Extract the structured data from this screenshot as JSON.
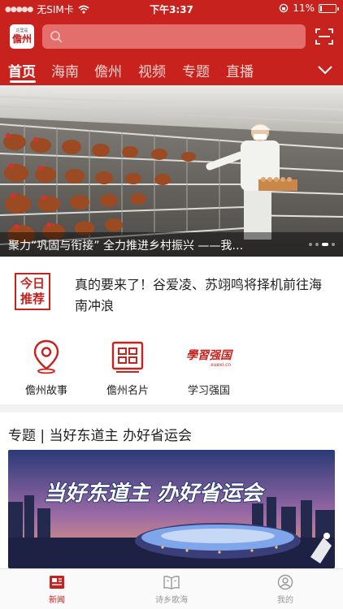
{
  "status_bar": {
    "carrier": "无SIM卡",
    "time": "下午3:37",
    "battery_percent": "11%",
    "battery_level": 0.11
  },
  "header": {
    "logo": {
      "small_text": "这里是",
      "big_text": "儋州"
    },
    "search": {
      "placeholder": ""
    },
    "tabs": [
      {
        "label": "首页",
        "active": true
      },
      {
        "label": "海南",
        "active": false
      },
      {
        "label": "儋州",
        "active": false
      },
      {
        "label": "视频",
        "active": false
      },
      {
        "label": "专题",
        "active": false
      },
      {
        "label": "直播",
        "active": false
      }
    ]
  },
  "banner": {
    "caption": "聚力“巩固与衔接” 全力推进乡村振兴 ——我…",
    "page_count": 4,
    "current_page": 3
  },
  "recommend": {
    "badge_line1": "今日",
    "badge_line2": "推荐",
    "headline": "真的要来了！谷爱凌、苏翊鸣将择机前往海南冲浪"
  },
  "shortcuts": [
    {
      "label": "儋州故事",
      "icon": "map-pin-icon"
    },
    {
      "label": "儋州名片",
      "icon": "card-grid-icon"
    },
    {
      "label": "学习强国",
      "icon": "xuexi-qiangguo-logo",
      "logo_text": "學習强国",
      "logo_subtext": "xuexi.cn"
    }
  ],
  "topic": {
    "title": "专题 | 当好东道主 办好省运会",
    "image_text": "当好东道主 办好省运会"
  },
  "bottom_nav": [
    {
      "label": "新闻",
      "active": true,
      "icon": "newspaper-icon"
    },
    {
      "label": "诗乡歌海",
      "active": false,
      "icon": "open-book-icon"
    },
    {
      "label": "我的",
      "active": false,
      "icon": "profile-icon"
    }
  ],
  "colors": {
    "brand_red": "#c8221f",
    "search_bg": "#e46e6b",
    "tab_inactive": "#fbd5d3"
  }
}
